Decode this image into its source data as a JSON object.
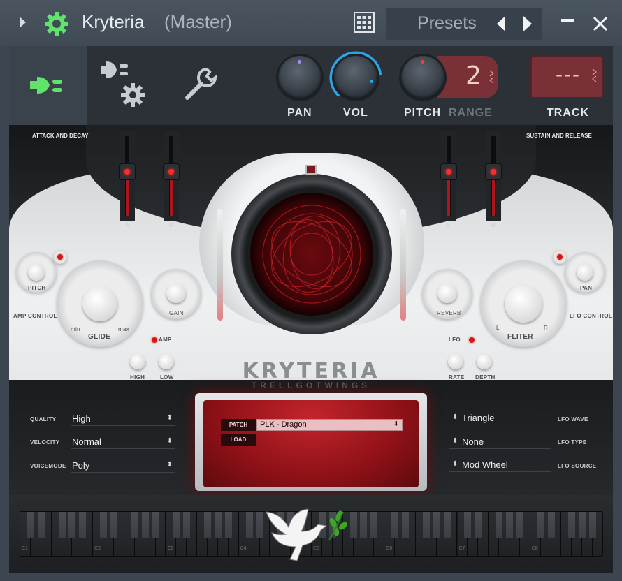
{
  "window": {
    "title": "Kryteria",
    "subtitle": "(Master)",
    "presets_label": "Presets"
  },
  "header": {
    "pan_label": "PAN",
    "vol_label": "VOL",
    "pitch_label": "PITCH",
    "range_label": "RANGE",
    "range_value": "2",
    "track_label": "TRACK",
    "track_value": "---",
    "vol_level": 0.8
  },
  "plugin": {
    "attack_decay_label": "ATTACK AND DECAY",
    "sustain_release_label": "SUSTAIN AND RELEASE",
    "sliders": [
      {
        "label": "A",
        "level": 0.55
      },
      {
        "label": "D",
        "level": 0.55
      },
      {
        "label": "S",
        "level": 0.55
      },
      {
        "label": "R",
        "level": 0.55
      }
    ],
    "pitch_knob_label": "PITCH",
    "pan_knob_label": "PAN",
    "amp_control_label": "AMP CONTROL",
    "lfo_control_label": "LFO CONTROL",
    "glide_label": "GLIDE",
    "glide_min": "min",
    "glide_max": "max",
    "gain_label": "GAIN",
    "reverb_label": "REVERB",
    "fliter_label": "FLITER",
    "fliter_l": "L",
    "fliter_r": "R",
    "amp_label": "AMP",
    "high_label": "HIGH",
    "low_label": "LOW",
    "lfo_label": "LFO",
    "rate_label": "RATE",
    "depth_label": "DEPTH",
    "logo": "KRYTERIA",
    "sublogo": "TRELLGOTWINGS"
  },
  "settings_left": [
    {
      "label": "QUALITY",
      "value": "High"
    },
    {
      "label": "VELOCITY",
      "value": "Normal"
    },
    {
      "label": "VOICEMODE",
      "value": "Poly"
    }
  ],
  "settings_right": [
    {
      "label": "LFO WAVE",
      "value": "Triangle"
    },
    {
      "label": "LFO TYPE",
      "value": "None"
    },
    {
      "label": "LFO SOURCE",
      "value": "Mod Wheel"
    }
  ],
  "patch": {
    "patch_button": "PATCH",
    "load_button": "LOAD",
    "selected_patch": "PLK - Dragon"
  },
  "keyboard": {
    "octave_labels": [
      "C1",
      "C2",
      "C3",
      "C4",
      "C5",
      "C6",
      "C7",
      "C8"
    ]
  },
  "colors": {
    "accent_green": "#5fe36a",
    "accent_blue": "#2ea3e6",
    "led_red": "#ff2a2a",
    "patch_red": "#a91a21"
  }
}
